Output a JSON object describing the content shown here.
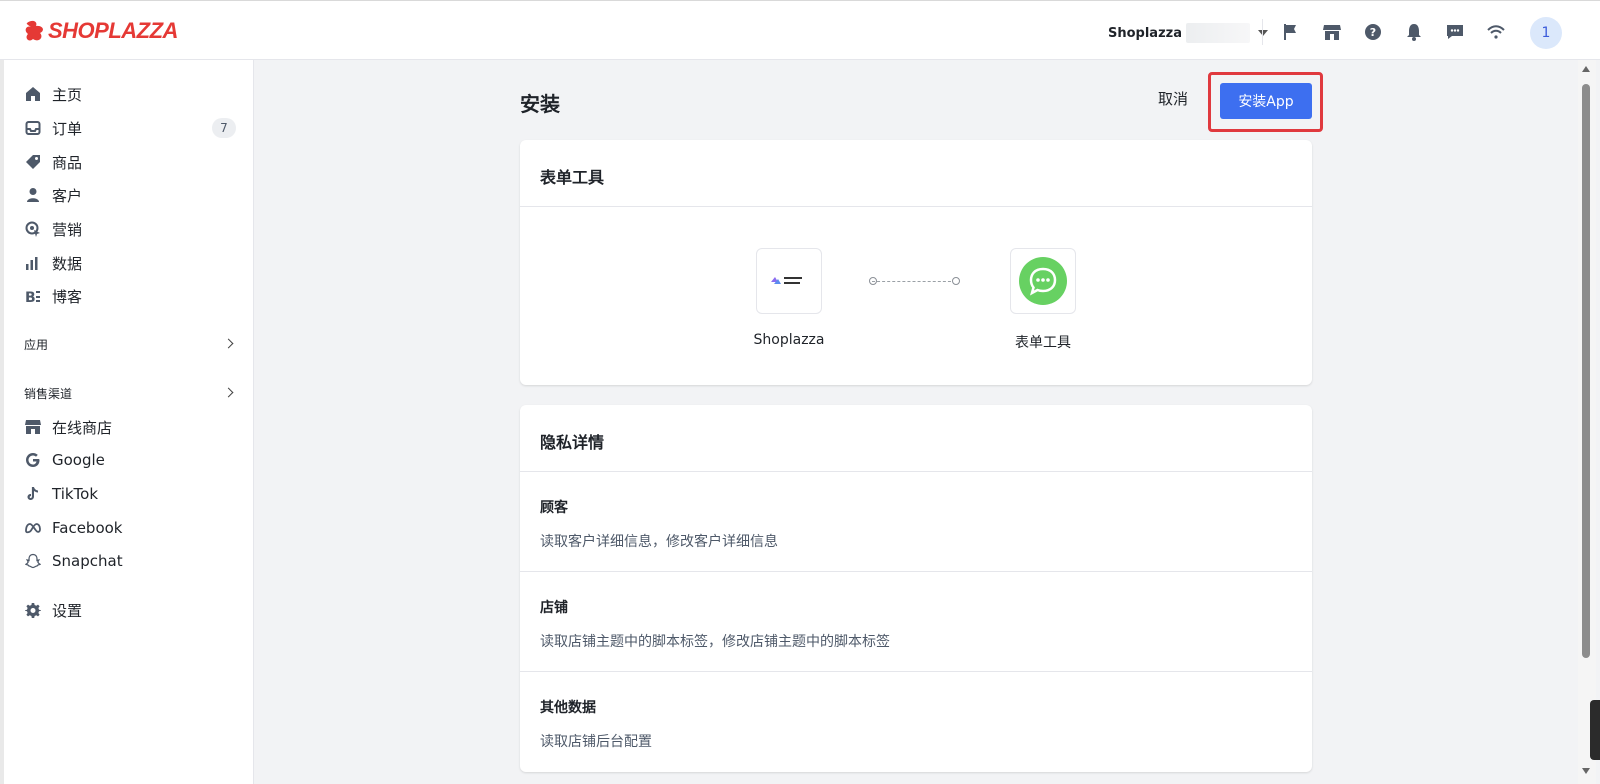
{
  "brand": {
    "name": "SHOPLAZZA",
    "color": "#e53935"
  },
  "topbar": {
    "store_name": "Shoplazza",
    "icons": [
      "flag-icon",
      "store-icon",
      "help-icon",
      "bell-icon",
      "message-icon",
      "wifi-icon"
    ],
    "avatar_text": "1"
  },
  "sidebar": {
    "items": [
      {
        "label": "主页",
        "icon": "home-icon"
      },
      {
        "label": "订单",
        "icon": "inbox-icon",
        "badge": "7"
      },
      {
        "label": "商品",
        "icon": "tag-icon"
      },
      {
        "label": "客户",
        "icon": "person-icon"
      },
      {
        "label": "营销",
        "icon": "marketing-icon"
      },
      {
        "label": "数据",
        "icon": "bar-chart-icon"
      },
      {
        "label": "博客",
        "icon": "blog-icon"
      }
    ],
    "apps_section": "应用",
    "channels_section": "销售渠道",
    "channels": [
      {
        "label": "在线商店",
        "icon": "store-icon"
      },
      {
        "label": "Google",
        "icon": "google-icon"
      },
      {
        "label": "TikTok",
        "icon": "tiktok-icon"
      },
      {
        "label": "Facebook",
        "icon": "meta-icon"
      },
      {
        "label": "Snapchat",
        "icon": "snapchat-icon"
      }
    ],
    "settings": {
      "label": "设置",
      "icon": "gear-icon"
    }
  },
  "page": {
    "title": "安装",
    "cancel_label": "取消",
    "install_label": "安装App",
    "accent": "#3d6ff0",
    "highlight_color": "#e0393e"
  },
  "app_card": {
    "title": "表单工具",
    "source_label": "Shoplazza",
    "target_label": "表单工具"
  },
  "privacy_card": {
    "title": "隐私详情",
    "permissions": [
      {
        "title": "顾客",
        "desc": "读取客户详细信息，修改客户详细信息"
      },
      {
        "title": "店铺",
        "desc": "读取店铺主题中的脚本标签，修改店铺主题中的脚本标签"
      },
      {
        "title": "其他数据",
        "desc": "读取店铺后台配置"
      }
    ]
  }
}
